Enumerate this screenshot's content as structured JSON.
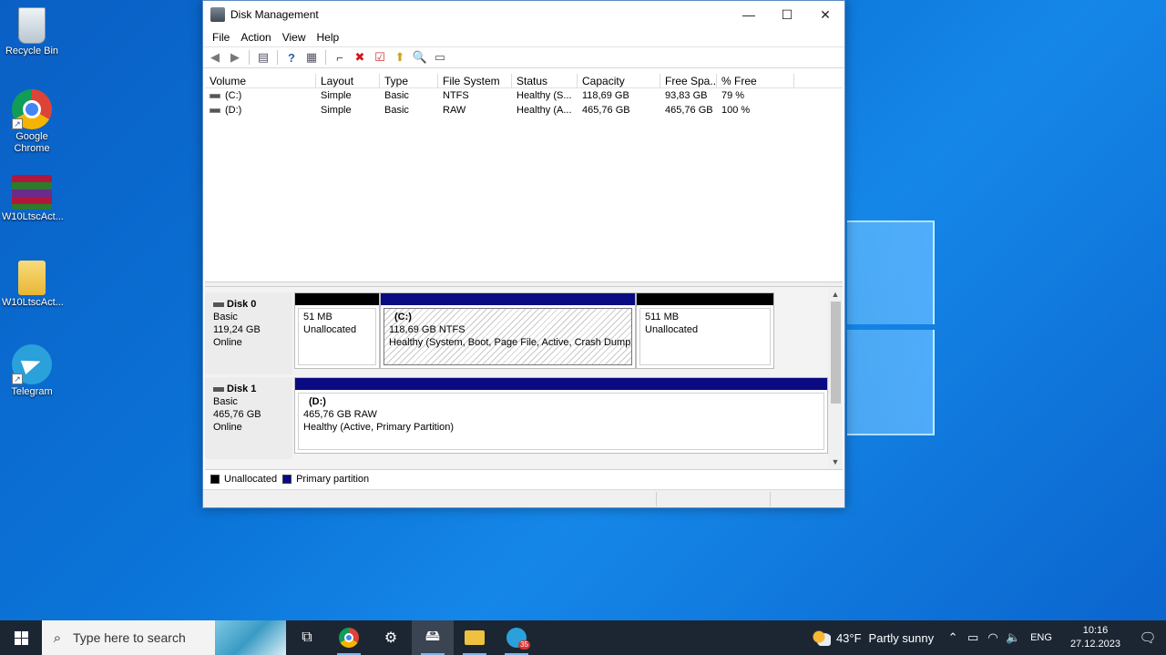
{
  "desktop": {
    "icons": [
      {
        "label": "Recycle Bin"
      },
      {
        "label": "Google Chrome"
      },
      {
        "label": "W10LtscAct..."
      },
      {
        "label": "W10LtscAct..."
      },
      {
        "label": "Telegram"
      }
    ]
  },
  "window": {
    "title": "Disk Management",
    "controls": {
      "minimize": "—",
      "maximize": "☐",
      "close": "✕"
    },
    "menu": [
      "File",
      "Action",
      "View",
      "Help"
    ],
    "toolbar_icons": [
      "back-arrow-icon",
      "forward-arrow-icon",
      "console-tree-icon",
      "help-icon",
      "properties-icon",
      "connect-icon",
      "delete-icon",
      "check-icon",
      "refresh-icon",
      "rescan-icon",
      "settings-icon"
    ],
    "volume_list": {
      "columns": [
        "Volume",
        "Layout",
        "Type",
        "File System",
        "Status",
        "Capacity",
        "Free Spa...",
        "% Free"
      ],
      "rows": [
        [
          "(C:)",
          "Simple",
          "Basic",
          "NTFS",
          "Healthy (S...",
          "118,69 GB",
          "93,83 GB",
          "79 %"
        ],
        [
          "(D:)",
          "Simple",
          "Basic",
          "RAW",
          "Healthy (A...",
          "465,76 GB",
          "465,76 GB",
          "100 %"
        ]
      ]
    },
    "disks": [
      {
        "name": "Disk 0",
        "type": "Basic",
        "size": "119,24 GB",
        "status": "Online",
        "partitions": [
          {
            "volume": "",
            "line1": "51 MB",
            "line2": "Unallocated"
          },
          {
            "volume": "(C:)",
            "line1": "118,69 GB NTFS",
            "line2": "Healthy (System, Boot, Page File, Active, Crash Dump,"
          },
          {
            "volume": "",
            "line1": "511 MB",
            "line2": "Unallocated"
          }
        ]
      },
      {
        "name": "Disk 1",
        "type": "Basic",
        "size": "465,76 GB",
        "status": "Online",
        "partitions": [
          {
            "volume": "(D:)",
            "line1": "465,76 GB RAW",
            "line2": "Healthy (Active, Primary Partition)"
          }
        ]
      }
    ],
    "legend": [
      {
        "label": "Unallocated",
        "color": "#000000"
      },
      {
        "label": "Primary partition",
        "color": "#0a0a82"
      }
    ]
  },
  "taskbar": {
    "search_placeholder": "Type here to search",
    "telegram_badge": "35",
    "weather": {
      "temp": "43°F",
      "desc": "Partly sunny"
    },
    "language": "ENG",
    "time": "10:16",
    "date": "27.12.2023"
  }
}
